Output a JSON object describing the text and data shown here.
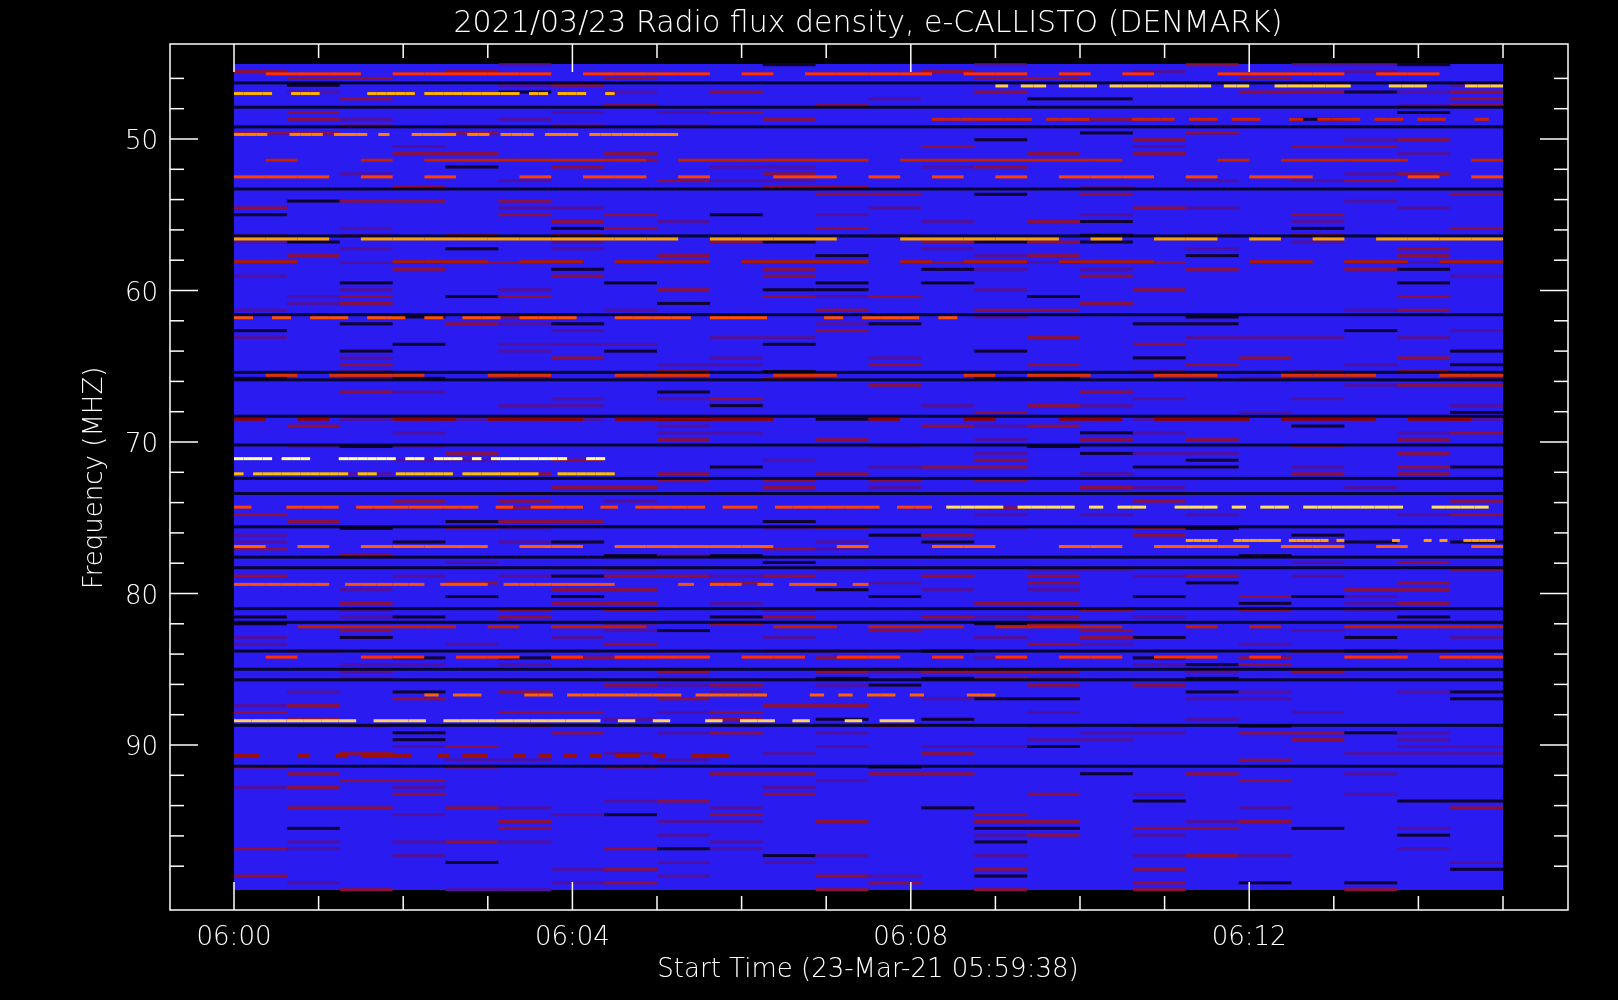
{
  "title": "2021/03/23  Radio flux density, e-CALLISTO (DENMARK)",
  "y_axis": {
    "label": "Frequency (MHZ)",
    "ticks": [
      "50",
      "60",
      "70",
      "80",
      "90"
    ]
  },
  "x_axis": {
    "label": "Start Time (23-Mar-21 05:59:38)",
    "ticks": [
      "06:00",
      "06:04",
      "06:08",
      "06:12"
    ]
  }
}
